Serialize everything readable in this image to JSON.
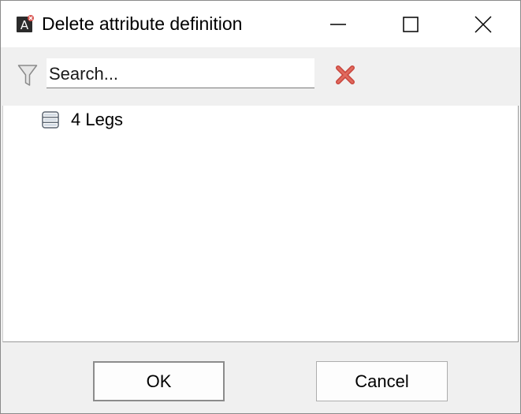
{
  "window": {
    "title": "Delete attribute definition"
  },
  "titlebar_buttons": {
    "minimize_icon": "minimize-icon",
    "maximize_icon": "maximize-icon",
    "close_icon": "close-icon"
  },
  "toolbar": {
    "filter_icon": "filter-icon",
    "search": {
      "placeholder": "Search...",
      "value": ""
    },
    "clear_icon": "red-x-icon"
  },
  "list": {
    "items": [
      {
        "label": "4 Legs",
        "icon": "attribute-definition-icon"
      }
    ]
  },
  "buttons": {
    "ok_label": "OK",
    "cancel_label": "Cancel"
  },
  "colors": {
    "clear_icon": "#d9534f",
    "window_bg": "#f0f0f0"
  }
}
